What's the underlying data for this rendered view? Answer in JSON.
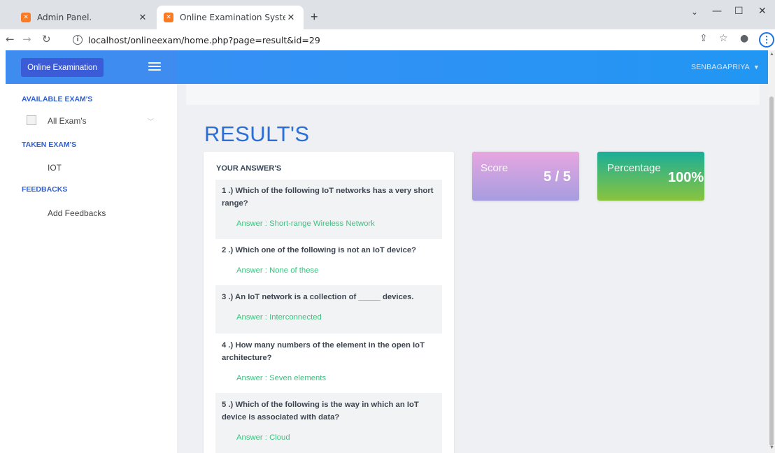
{
  "browser": {
    "tabs": [
      {
        "title": "Admin Panel.",
        "favicon": "xampp-icon"
      },
      {
        "title": "Online Examination System",
        "favicon": "xampp-icon"
      }
    ],
    "url": "localhost/onlineexam/home.php?page=result&id=29"
  },
  "app": {
    "brand": "Online Examination",
    "user": "SENBAGAPRIYA"
  },
  "sidebar": {
    "available_heading": "AVAILABLE EXAM'S",
    "all_exams": "All Exam's",
    "taken_heading": "TAKEN EXAM'S",
    "taken_items": [
      "IOT"
    ],
    "feedbacks_heading": "FEEDBACKS",
    "add_feedbacks": "Add Feedbacks"
  },
  "main": {
    "heading": "RESULT'S",
    "answers_title": "YOUR ANSWER'S",
    "answers": [
      {
        "question": "1 .) Which of the following IoT networks has a very short range?",
        "answer": "Answer : Short-range Wireless Network"
      },
      {
        "question": "2 .) Which one of the following is not an IoT device?",
        "answer": "Answer : None of these"
      },
      {
        "question": "3 .) An IoT network is a collection of _____ devices.",
        "answer": "Answer : Interconnected"
      },
      {
        "question": "4 .) How many numbers of the element in the open IoT architecture?",
        "answer": "Answer : Seven elements"
      },
      {
        "question": "5 .) Which of the following is the way in which an IoT device is associated with data?",
        "answer": "Answer : Cloud"
      }
    ],
    "score": {
      "label": "Score",
      "value": "5 / 5"
    },
    "percentage": {
      "label": "Percentage",
      "value": "100%"
    }
  },
  "colors": {
    "topbar": "#2196f3",
    "brand_button": "#3c5bd6",
    "heading": "#2a6fd8",
    "answer_text": "#3fbf7f"
  }
}
